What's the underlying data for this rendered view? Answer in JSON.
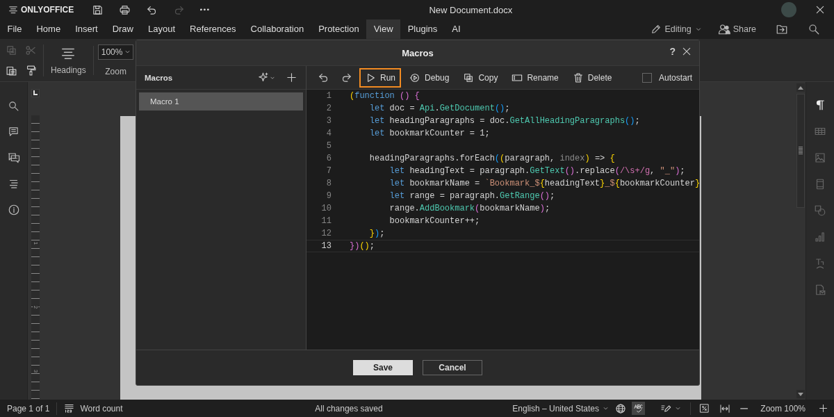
{
  "app": {
    "logo_text": "ONLYOFFICE",
    "document_title": "New Document.docx"
  },
  "quick_access": [
    {
      "kind": "save",
      "disabled": false
    },
    {
      "kind": "print",
      "disabled": false
    },
    {
      "kind": "undo",
      "disabled": false
    },
    {
      "kind": "redo",
      "disabled": true
    },
    {
      "kind": "more",
      "disabled": false
    }
  ],
  "menu_tabs": [
    {
      "label": "File",
      "selected": false
    },
    {
      "label": "Home",
      "selected": false
    },
    {
      "label": "Insert",
      "selected": false
    },
    {
      "label": "Draw",
      "selected": false
    },
    {
      "label": "Layout",
      "selected": false
    },
    {
      "label": "References",
      "selected": false
    },
    {
      "label": "Collaboration",
      "selected": false
    },
    {
      "label": "Protection",
      "selected": false
    },
    {
      "label": "View",
      "selected": true
    },
    {
      "label": "Plugins",
      "selected": false
    },
    {
      "label": "AI",
      "selected": false
    }
  ],
  "mode": {
    "label": "Editing"
  },
  "share": {
    "label": "Share"
  },
  "toolbar": {
    "clipboard": [
      {
        "kind": "copy",
        "disabled": true
      },
      {
        "kind": "cut",
        "disabled": true
      },
      {
        "kind": "paste",
        "disabled": false
      },
      {
        "kind": "format_painter",
        "disabled": false
      }
    ],
    "headings": "Headings",
    "zoom_value": "100%",
    "zoom_label": "Zoom"
  },
  "ruler": {
    "marks": [
      "1",
      "2",
      "3"
    ]
  },
  "right_sidebar": [
    {
      "kind": "paragraph",
      "selected": true
    },
    {
      "kind": "table",
      "selected": false
    },
    {
      "kind": "image",
      "selected": false
    },
    {
      "kind": "header_footer",
      "selected": false
    },
    {
      "kind": "shape",
      "selected": false
    },
    {
      "kind": "chart",
      "selected": false
    },
    {
      "kind": "text_art",
      "selected": false
    },
    {
      "kind": "mail_merge",
      "selected": false
    }
  ],
  "dialog": {
    "title": "Macros",
    "help": "?",
    "list_header": "Macros",
    "macros": [
      {
        "name": "Macro 1",
        "selected": true
      }
    ],
    "actions": [
      {
        "kind": "run",
        "label": "Run",
        "focused": true
      },
      {
        "kind": "debug",
        "label": "Debug",
        "focused": false
      },
      {
        "kind": "copy",
        "label": "Copy",
        "focused": false
      },
      {
        "kind": "rename",
        "label": "Rename",
        "focused": false
      },
      {
        "kind": "delete",
        "label": "Delete",
        "focused": false
      }
    ],
    "autostart": {
      "label": "Autostart",
      "checked": false
    },
    "code_lines": [
      {
        "number": "1",
        "current": false,
        "tokens": [
          {
            "kind": "b1",
            "text": "("
          },
          {
            "kind": "kw",
            "text": "function"
          },
          {
            "kind": "b2",
            "text": " ()"
          },
          {
            "kind": "b2",
            "text": " {"
          }
        ]
      },
      {
        "number": "2",
        "current": false,
        "tokens": [
          {
            "kind": "kw",
            "text": "    let"
          },
          {
            "kind": "plain",
            "text": " doc = "
          },
          {
            "kind": "fn",
            "text": "Api"
          },
          {
            "kind": "plain",
            "text": "."
          },
          {
            "kind": "fn",
            "text": "GetDocument"
          },
          {
            "kind": "b3",
            "text": "()"
          },
          {
            "kind": "plain",
            "text": ";"
          }
        ]
      },
      {
        "number": "3",
        "current": false,
        "tokens": [
          {
            "kind": "kw",
            "text": "    let"
          },
          {
            "kind": "plain",
            "text": " headingParagraphs = doc."
          },
          {
            "kind": "fn",
            "text": "GetAllHeadingParagraphs"
          },
          {
            "kind": "b3",
            "text": "()"
          },
          {
            "kind": "plain",
            "text": ";"
          }
        ]
      },
      {
        "number": "4",
        "current": false,
        "tokens": [
          {
            "kind": "kw",
            "text": "    let"
          },
          {
            "kind": "plain",
            "text": " bookmarkCounter = 1;"
          }
        ]
      },
      {
        "number": "5",
        "current": false
      },
      {
        "number": "6",
        "current": false,
        "tokens": [
          {
            "kind": "plain",
            "text": "    headingParagraphs.forEach"
          },
          {
            "kind": "b3",
            "text": "("
          },
          {
            "kind": "b1",
            "text": "("
          },
          {
            "kind": "plain",
            "text": "paragraph, "
          },
          {
            "kind": "dim",
            "text": "index"
          },
          {
            "kind": "b1",
            "text": ")"
          },
          {
            "kind": "plain",
            "text": " => "
          },
          {
            "kind": "b1",
            "text": "{"
          }
        ]
      },
      {
        "number": "7",
        "current": false,
        "tokens": [
          {
            "kind": "kw",
            "text": "        let"
          },
          {
            "kind": "plain",
            "text": " headingText = paragraph."
          },
          {
            "kind": "fn",
            "text": "GetText"
          },
          {
            "kind": "b2",
            "text": "()"
          },
          {
            "kind": "plain",
            "text": ".replace"
          },
          {
            "kind": "b2",
            "text": "("
          },
          {
            "kind": "re",
            "text": "/\\s+/g"
          },
          {
            "kind": "plain",
            "text": ", "
          },
          {
            "kind": "str",
            "text": "\"_\""
          },
          {
            "kind": "b2",
            "text": ")"
          },
          {
            "kind": "plain",
            "text": ";"
          }
        ]
      },
      {
        "number": "8",
        "current": false,
        "tokens": [
          {
            "kind": "kw",
            "text": "        let"
          },
          {
            "kind": "plain",
            "text": " bookmarkName = "
          },
          {
            "kind": "str",
            "text": "`Bookmark_$"
          },
          {
            "kind": "b1",
            "text": "{"
          },
          {
            "kind": "plain",
            "text": "headingText"
          },
          {
            "kind": "b1",
            "text": "}"
          },
          {
            "kind": "str",
            "text": "_$"
          },
          {
            "kind": "b1",
            "text": "{"
          },
          {
            "kind": "plain",
            "text": "bookmarkCounter"
          },
          {
            "kind": "b1",
            "text": "}"
          }
        ]
      },
      {
        "number": "9",
        "current": false,
        "tokens": [
          {
            "kind": "kw",
            "text": "        let"
          },
          {
            "kind": "plain",
            "text": " range = paragraph."
          },
          {
            "kind": "fn",
            "text": "GetRange"
          },
          {
            "kind": "b2",
            "text": "()"
          },
          {
            "kind": "plain",
            "text": ";"
          }
        ]
      },
      {
        "number": "10",
        "current": false,
        "tokens": [
          {
            "kind": "plain",
            "text": "        range."
          },
          {
            "kind": "fn",
            "text": "AddBookmark"
          },
          {
            "kind": "b2",
            "text": "("
          },
          {
            "kind": "plain",
            "text": "bookmarkName"
          },
          {
            "kind": "b2",
            "text": ")"
          },
          {
            "kind": "plain",
            "text": ";"
          }
        ]
      },
      {
        "number": "11",
        "current": false,
        "tokens": [
          {
            "kind": "plain",
            "text": "        bookmarkCounter++;"
          }
        ]
      },
      {
        "number": "12",
        "current": false,
        "tokens": [
          {
            "kind": "b1",
            "text": "    }"
          },
          {
            "kind": "b3",
            "text": ")"
          },
          {
            "kind": "plain",
            "text": ";"
          }
        ]
      },
      {
        "number": "13",
        "current": true,
        "tokens": [
          {
            "kind": "b2",
            "text": "})"
          },
          {
            "kind": "b1",
            "text": "()"
          },
          {
            "kind": "plain",
            "text": ";"
          }
        ]
      }
    ],
    "buttons": [
      {
        "label": "Save",
        "primary": true
      },
      {
        "label": "Cancel",
        "primary": false
      }
    ]
  },
  "status_bar": {
    "page": "Page 1 of 1",
    "word_count": "Word count",
    "save_status": "All changes saved",
    "language": "English – United States",
    "spell_check_on": true,
    "zoom": "Zoom 100%"
  }
}
